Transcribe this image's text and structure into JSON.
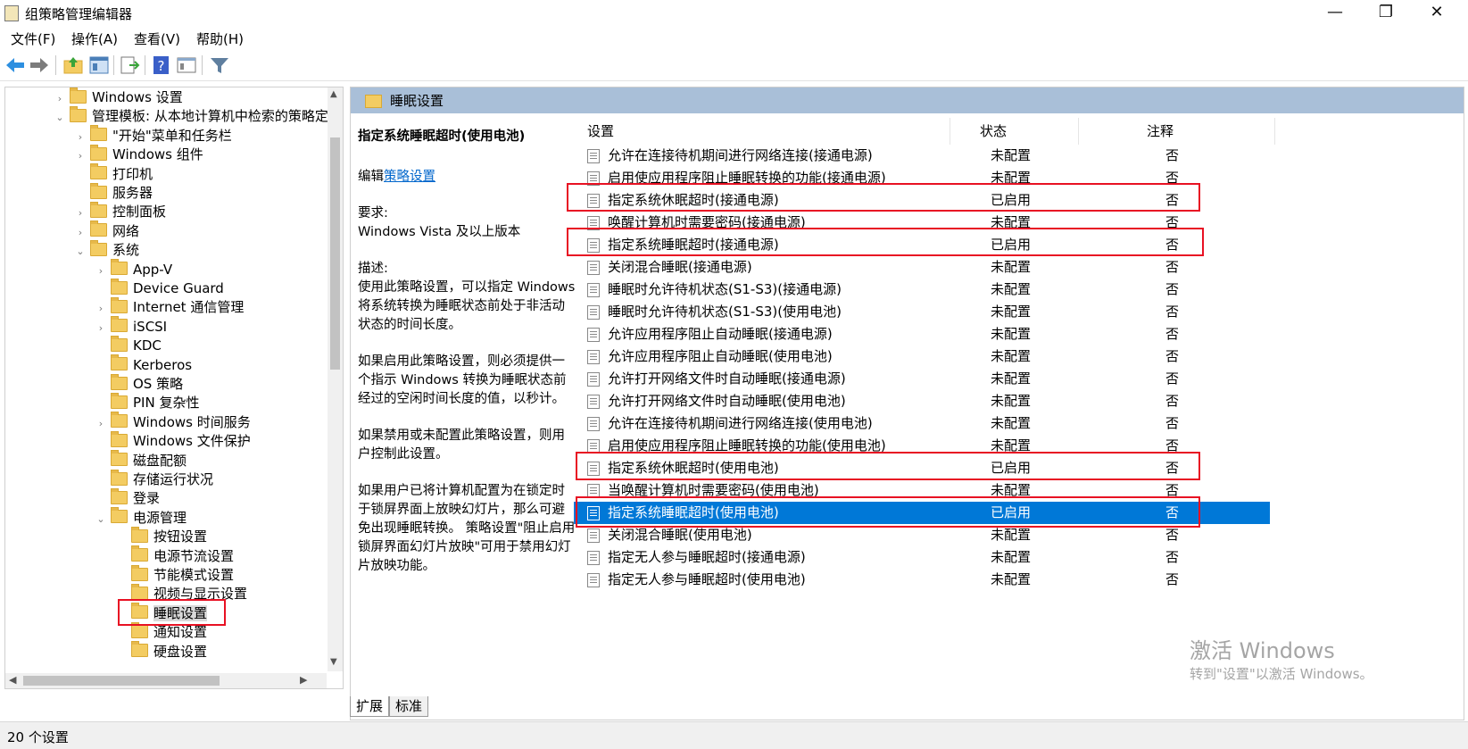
{
  "window": {
    "title": "组策略管理编辑器"
  },
  "menu": [
    "文件(F)",
    "操作(A)",
    "查看(V)",
    "帮助(H)"
  ],
  "toolbar": [
    "back-icon",
    "forward-icon",
    "up-folder-icon",
    "show-hide-tree-icon",
    "export-list-icon",
    "help-icon",
    "properties-icon",
    "filter-icon"
  ],
  "tree": {
    "nodes": [
      {
        "label": "Windows 设置",
        "expander": "›"
      },
      {
        "label": "管理模板: 从本地计算机中检索的策略定",
        "expander": "⌄"
      },
      {
        "label": "\"开始\"菜单和任务栏",
        "expander": "›"
      },
      {
        "label": "Windows 组件",
        "expander": "›"
      },
      {
        "label": "打印机",
        "expander": ""
      },
      {
        "label": "服务器",
        "expander": ""
      },
      {
        "label": "控制面板",
        "expander": "›"
      },
      {
        "label": "网络",
        "expander": "›"
      },
      {
        "label": "系统",
        "expander": "⌄"
      },
      {
        "label": "App-V",
        "expander": "›"
      },
      {
        "label": "Device Guard",
        "expander": ""
      },
      {
        "label": "Internet 通信管理",
        "expander": "›"
      },
      {
        "label": "iSCSI",
        "expander": "›"
      },
      {
        "label": "KDC",
        "expander": ""
      },
      {
        "label": "Kerberos",
        "expander": ""
      },
      {
        "label": "OS 策略",
        "expander": ""
      },
      {
        "label": "PIN 复杂性",
        "expander": ""
      },
      {
        "label": "Windows 时间服务",
        "expander": "›"
      },
      {
        "label": "Windows 文件保护",
        "expander": ""
      },
      {
        "label": "磁盘配额",
        "expander": ""
      },
      {
        "label": "存储运行状况",
        "expander": ""
      },
      {
        "label": "登录",
        "expander": ""
      },
      {
        "label": "电源管理",
        "expander": "⌄"
      },
      {
        "label": "按钮设置",
        "expander": ""
      },
      {
        "label": "电源节流设置",
        "expander": ""
      },
      {
        "label": "节能模式设置",
        "expander": ""
      },
      {
        "label": "视频与显示设置",
        "expander": ""
      },
      {
        "label": "睡眠设置",
        "expander": ""
      },
      {
        "label": "通知设置",
        "expander": ""
      },
      {
        "label": "硬盘设置",
        "expander": ""
      }
    ]
  },
  "right": {
    "header": "睡眠设置",
    "desc": {
      "title": "指定系统睡眠超时(使用电池)",
      "edit_prefix": "编辑",
      "edit_link": "策略设置",
      "req_label": "要求:",
      "req_value": "Windows Vista 及以上版本",
      "desc_label": "描述:",
      "p1": "使用此策略设置，可以指定 Windows 将系统转换为睡眠状态前处于非活动状态的时间长度。",
      "p2": "如果启用此策略设置，则必须提供一个指示 Windows 转换为睡眠状态前经过的空闲时间长度的值，以秒计。",
      "p3": "如果禁用或未配置此策略设置，则用户控制此设置。",
      "p4": "如果用户已将计算机配置为在锁定时于锁屏界面上放映幻灯片，那么可避免出现睡眠转换。 策略设置\"阻止启用锁屏界面幻灯片放映\"可用于禁用幻灯片放映功能。"
    },
    "columns": {
      "setting": "设置",
      "state": "状态",
      "comment": "注释"
    },
    "rows": [
      {
        "name": "允许在连接待机期间进行网络连接(接通电源)",
        "state": "未配置",
        "comment": "否"
      },
      {
        "name": "启用使应用程序阻止睡眠转换的功能(接通电源)",
        "state": "未配置",
        "comment": "否"
      },
      {
        "name": "指定系统休眠超时(接通电源)",
        "state": "已启用",
        "comment": "否"
      },
      {
        "name": "唤醒计算机时需要密码(接通电源)",
        "state": "未配置",
        "comment": "否"
      },
      {
        "name": "指定系统睡眠超时(接通电源)",
        "state": "已启用",
        "comment": "否"
      },
      {
        "name": "关闭混合睡眠(接通电源)",
        "state": "未配置",
        "comment": "否"
      },
      {
        "name": "睡眠时允许待机状态(S1-S3)(接通电源)",
        "state": "未配置",
        "comment": "否"
      },
      {
        "name": "睡眠时允许待机状态(S1-S3)(使用电池)",
        "state": "未配置",
        "comment": "否"
      },
      {
        "name": "允许应用程序阻止自动睡眠(接通电源)",
        "state": "未配置",
        "comment": "否"
      },
      {
        "name": "允许应用程序阻止自动睡眠(使用电池)",
        "state": "未配置",
        "comment": "否"
      },
      {
        "name": "允许打开网络文件时自动睡眠(接通电源)",
        "state": "未配置",
        "comment": "否"
      },
      {
        "name": "允许打开网络文件时自动睡眠(使用电池)",
        "state": "未配置",
        "comment": "否"
      },
      {
        "name": "允许在连接待机期间进行网络连接(使用电池)",
        "state": "未配置",
        "comment": "否"
      },
      {
        "name": "启用使应用程序阻止睡眠转换的功能(使用电池)",
        "state": "未配置",
        "comment": "否"
      },
      {
        "name": "指定系统休眠超时(使用电池)",
        "state": "已启用",
        "comment": "否"
      },
      {
        "name": "当唤醒计算机时需要密码(使用电池)",
        "state": "未配置",
        "comment": "否"
      },
      {
        "name": "指定系统睡眠超时(使用电池)",
        "state": "已启用",
        "comment": "否"
      },
      {
        "name": "关闭混合睡眠(使用电池)",
        "state": "未配置",
        "comment": "否"
      },
      {
        "name": "指定无人参与睡眠超时(接通电源)",
        "state": "未配置",
        "comment": "否"
      },
      {
        "name": "指定无人参与睡眠超时(使用电池)",
        "state": "未配置",
        "comment": "否"
      }
    ]
  },
  "tabs": [
    "扩展",
    "标准"
  ],
  "status": "20 个设置",
  "watermark": {
    "line1": "激活 Windows",
    "line2": "转到\"设置\"以激活 Windows。"
  },
  "colors": {
    "selection": "#0078d7",
    "header_bar": "#a9bfd8",
    "highlight_box": "#e81123",
    "folder": "#f3cc62"
  }
}
